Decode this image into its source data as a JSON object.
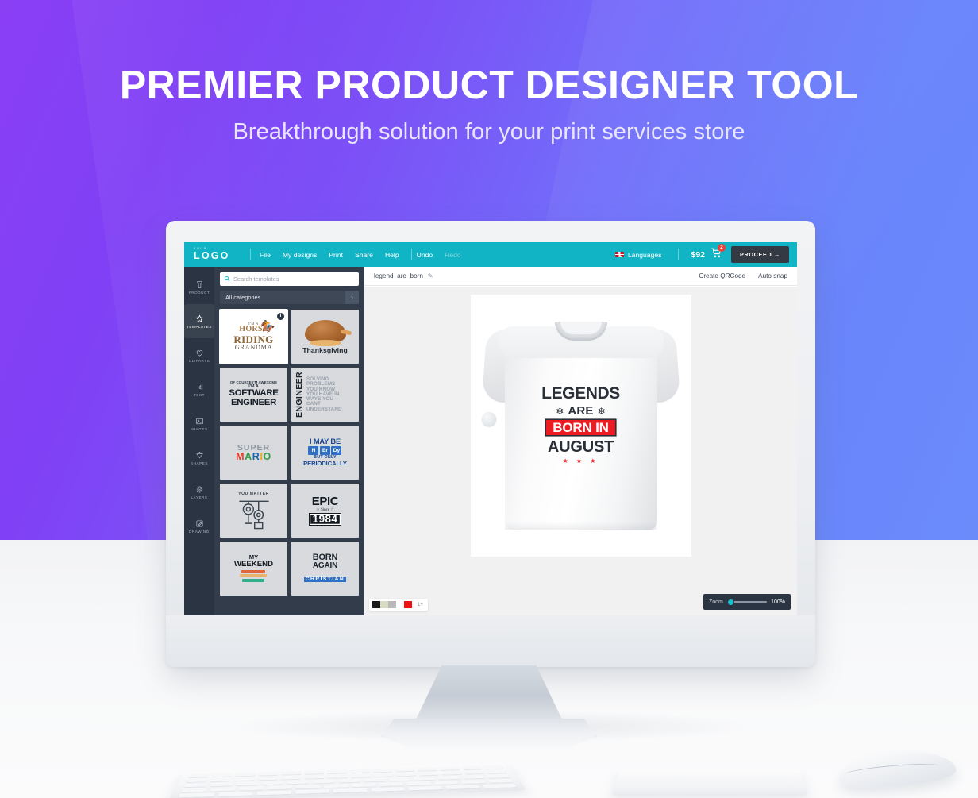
{
  "hero": {
    "headline": "PREMIER PRODUCT DESIGNER TOOL",
    "subheadline": "Breakthrough solution for your print services store",
    "gradient_start": "#8a3ff5",
    "gradient_end": "#6b8bfb"
  },
  "app": {
    "accent_color": "#11b4c4",
    "topbar": {
      "logo_small": "YOUR",
      "logo": "LOGO",
      "menu": [
        {
          "label": "File"
        },
        {
          "label": "My designs"
        },
        {
          "label": "Print"
        },
        {
          "label": "Share"
        },
        {
          "label": "Help"
        }
      ],
      "undo": "Undo",
      "redo": "Redo",
      "languages": "Languages",
      "flag_icon": "uk-flag-icon",
      "price": "$92",
      "cart_icon": "cart-icon",
      "cart_count": "2",
      "cart_badge_color": "#ef3e36",
      "proceed": "PROCEED →"
    },
    "rail": [
      {
        "label": "PRODUCT",
        "icon": "tshirt-icon",
        "active": false
      },
      {
        "label": "TEMPLATES",
        "icon": "star-icon",
        "active": true
      },
      {
        "label": "CLIPARTS",
        "icon": "heart-icon",
        "active": false
      },
      {
        "label": "TEXT",
        "icon": "text-icon",
        "active": false
      },
      {
        "label": "IMAGES",
        "icon": "image-icon",
        "active": false
      },
      {
        "label": "SHAPES",
        "icon": "shapes-icon",
        "active": false
      },
      {
        "label": "LAYERS",
        "icon": "layers-icon",
        "active": false
      },
      {
        "label": "DRAWING",
        "icon": "drawing-icon",
        "active": false
      }
    ],
    "panel": {
      "search_placeholder": "Search templates",
      "search_icon": "search-icon",
      "category_label": "All categories",
      "category_arrow_icon": "chevron-right-icon",
      "templates": [
        {
          "id": "horse-riding-grandma",
          "badge": "i",
          "lines": [
            "I'M A",
            "HORSE",
            "RIDING",
            "GRANDMA"
          ]
        },
        {
          "id": "thanksgiving",
          "caption": "Thanksgiving"
        },
        {
          "id": "software-engineer",
          "lines": [
            "OF COURSE I'M AWESOME",
            "I'M A",
            "SOFTWARE",
            "ENGINEER"
          ]
        },
        {
          "id": "engineer-solving",
          "vertical": "ENGINEER",
          "stack": [
            "SOLVING",
            "PROBLEMS",
            "YOU KNOW",
            "YOU HAVE IN",
            "WAYS YOU",
            "CANT",
            "UNDERSTAND"
          ]
        },
        {
          "id": "super-mario",
          "lines": [
            "SUPER",
            "MARIO"
          ]
        },
        {
          "id": "nerdy-periodically",
          "lines": [
            "I MAY BE",
            "BUT ONLY",
            "PERIODICALLY"
          ],
          "elements": [
            "N",
            "Er",
            "Dy"
          ]
        },
        {
          "id": "you-matter",
          "caption": "YOU MATTER"
        },
        {
          "id": "epic-since-1984",
          "lines": [
            "EPIC",
            "Since",
            "1984"
          ]
        },
        {
          "id": "my-weekend",
          "lines": [
            "MY",
            "WEEKEND"
          ]
        },
        {
          "id": "born-again-christian",
          "lines": [
            "BORN",
            "AGAIN",
            "CHRISTIAN"
          ]
        }
      ]
    },
    "canvas": {
      "file_name": "legend_are_born",
      "edit_icon": "pencil-icon",
      "actions": [
        {
          "label": "Create QRCode"
        },
        {
          "label": "Auto snap"
        }
      ],
      "design": {
        "line1": "LEGENDS",
        "line2": "ARE",
        "line3": "BORN IN",
        "line4": "AUGUST",
        "stars": "★ ★ ★",
        "highlight_color": "#ed1c24",
        "text_color": "#2b3038",
        "wing_icon": "wing-icon"
      },
      "swatches": [
        "#1a1a1a",
        "#d9dcc0",
        "#b9b9b9",
        "#ffffff",
        "#f01010"
      ],
      "swatch_more": "1+",
      "zoom": {
        "label": "Zoom",
        "value": "100%"
      }
    }
  }
}
